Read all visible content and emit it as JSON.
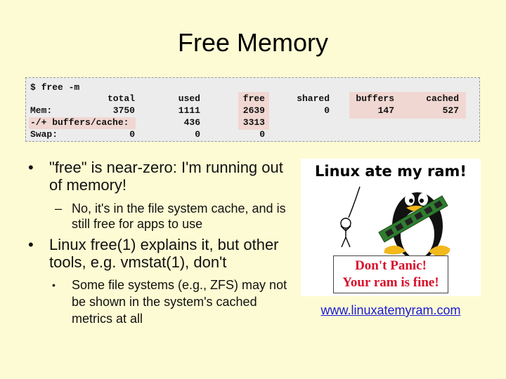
{
  "slide": {
    "title": "Free Memory",
    "terminal": {
      "command": "$ free -m",
      "headers": [
        "total",
        "used",
        "free",
        "shared",
        "buffers",
        "cached"
      ],
      "rows": [
        {
          "label": "Mem:",
          "values": [
            "3750",
            "1111",
            "2639",
            "0",
            "147",
            "527"
          ]
        },
        {
          "label": "-/+ buffers/cache:",
          "values": [
            "",
            "436",
            "3313",
            "",
            "",
            ""
          ]
        },
        {
          "label": "Swap:",
          "values": [
            "0",
            "0",
            "0",
            "",
            "",
            ""
          ]
        }
      ]
    },
    "bullets": [
      {
        "text": "\"free\" is near-zero: I'm running out of memory!"
      },
      {
        "text": "No, it's in the file system cache, and is still free for apps to use"
      },
      {
        "text": "Linux free(1) explains it, but other tools, e.g. vmstat(1), don't"
      },
      {
        "text": "Some file systems (e.g., ZFS) may not be shown in the system's cached metrics at all"
      }
    ],
    "bullet_marks": {
      "level1": "•",
      "level2": "–",
      "level3": "•"
    },
    "meme": {
      "title": "Linux ate my ram!",
      "caption_line1": "Don't Panic!",
      "caption_line2": "Your ram is fine!"
    },
    "link_text": "www.linuxatemyram.com",
    "colors": {
      "background": "#fdfbd3",
      "terminal_bg": "#ececec",
      "highlight": "#f0d7d2",
      "caption_red": "#d8102b",
      "link_blue": "#1a1ad6"
    }
  }
}
